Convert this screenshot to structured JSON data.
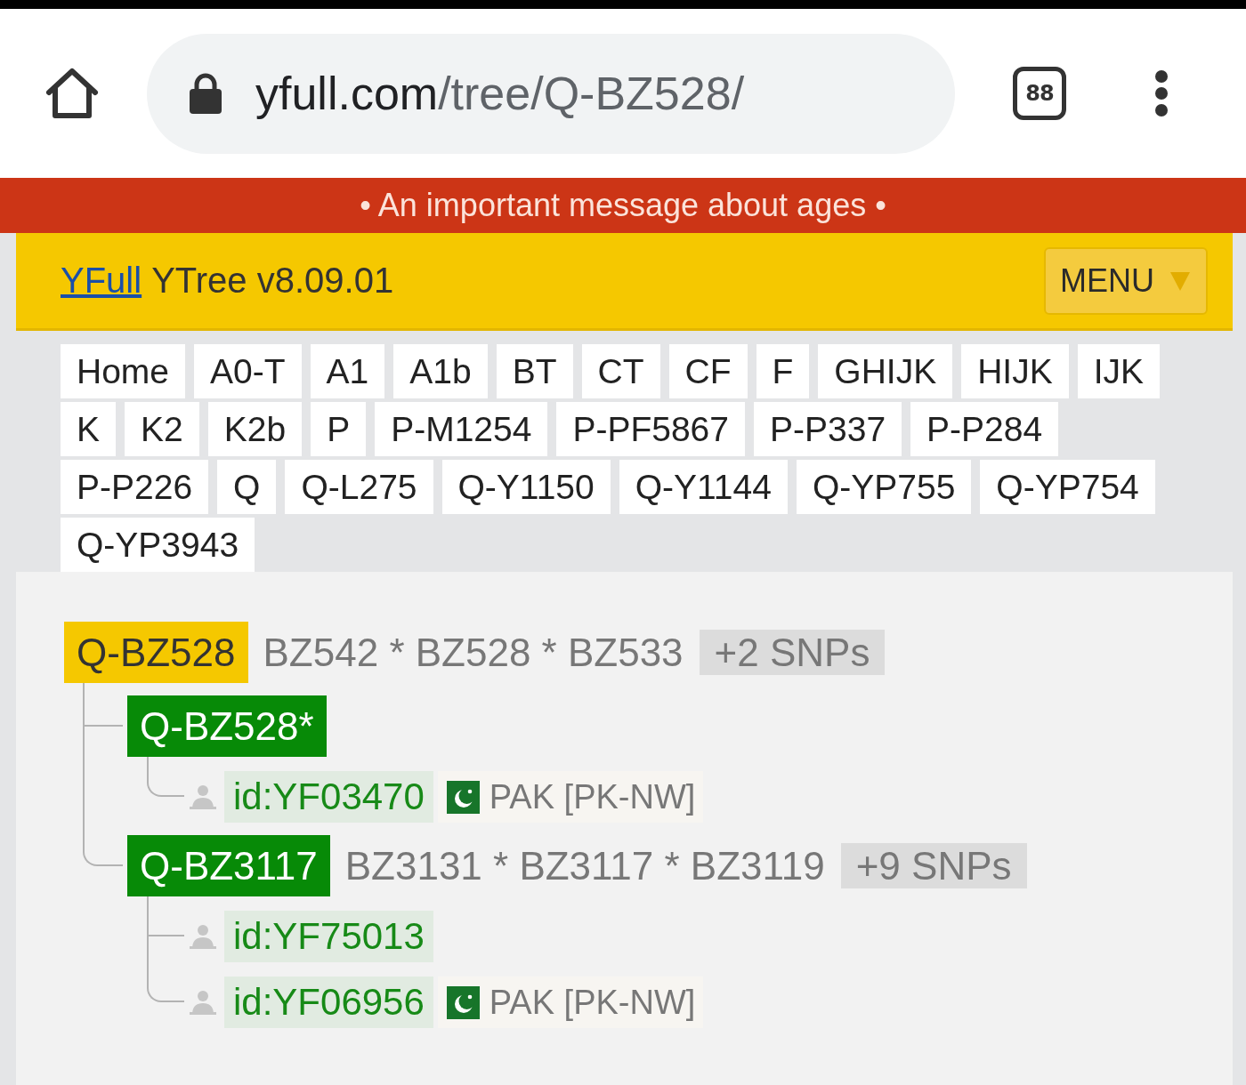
{
  "browser": {
    "url_host": "yfull.com",
    "url_path": "/tree/Q-BZ528/",
    "tab_count": "88"
  },
  "banner": {
    "text": "• An important message about ages •"
  },
  "header": {
    "brand_link": "YFull",
    "title": "YTree v8.09.01",
    "menu_button": "MENU"
  },
  "nav_links": [
    "Home",
    "A0-T",
    "A1",
    "A1b",
    "BT",
    "CT",
    "CF",
    "F",
    "GHIJK",
    "HIJK",
    "IJK",
    "K",
    "K2",
    "K2b",
    "P",
    "P-M1254",
    "P-PF5867",
    "P-P337",
    "P-P284",
    "P-P226",
    "Q",
    "Q-L275",
    "Q-Y1150",
    "Q-Y1144",
    "Q-YP755",
    "Q-YP754",
    "Q-YP3943"
  ],
  "tree": {
    "label": "Q-BZ528",
    "kind": "current",
    "snps": "BZ542 * BZ528 * BZ533",
    "more_snps": "+2 SNPs",
    "children": [
      {
        "label": "Q-BZ528*",
        "kind": "subclade",
        "samples": [
          {
            "id": "id:YF03470",
            "country": "PAK [PK-NW]"
          }
        ]
      },
      {
        "label": "Q-BZ3117",
        "kind": "subclade",
        "snps": "BZ3131 * BZ3117 * BZ3119",
        "more_snps": "+9 SNPs",
        "samples": [
          {
            "id": "id:YF75013"
          },
          {
            "id": "id:YF06956",
            "country": "PAK [PK-NW]"
          }
        ]
      }
    ]
  }
}
